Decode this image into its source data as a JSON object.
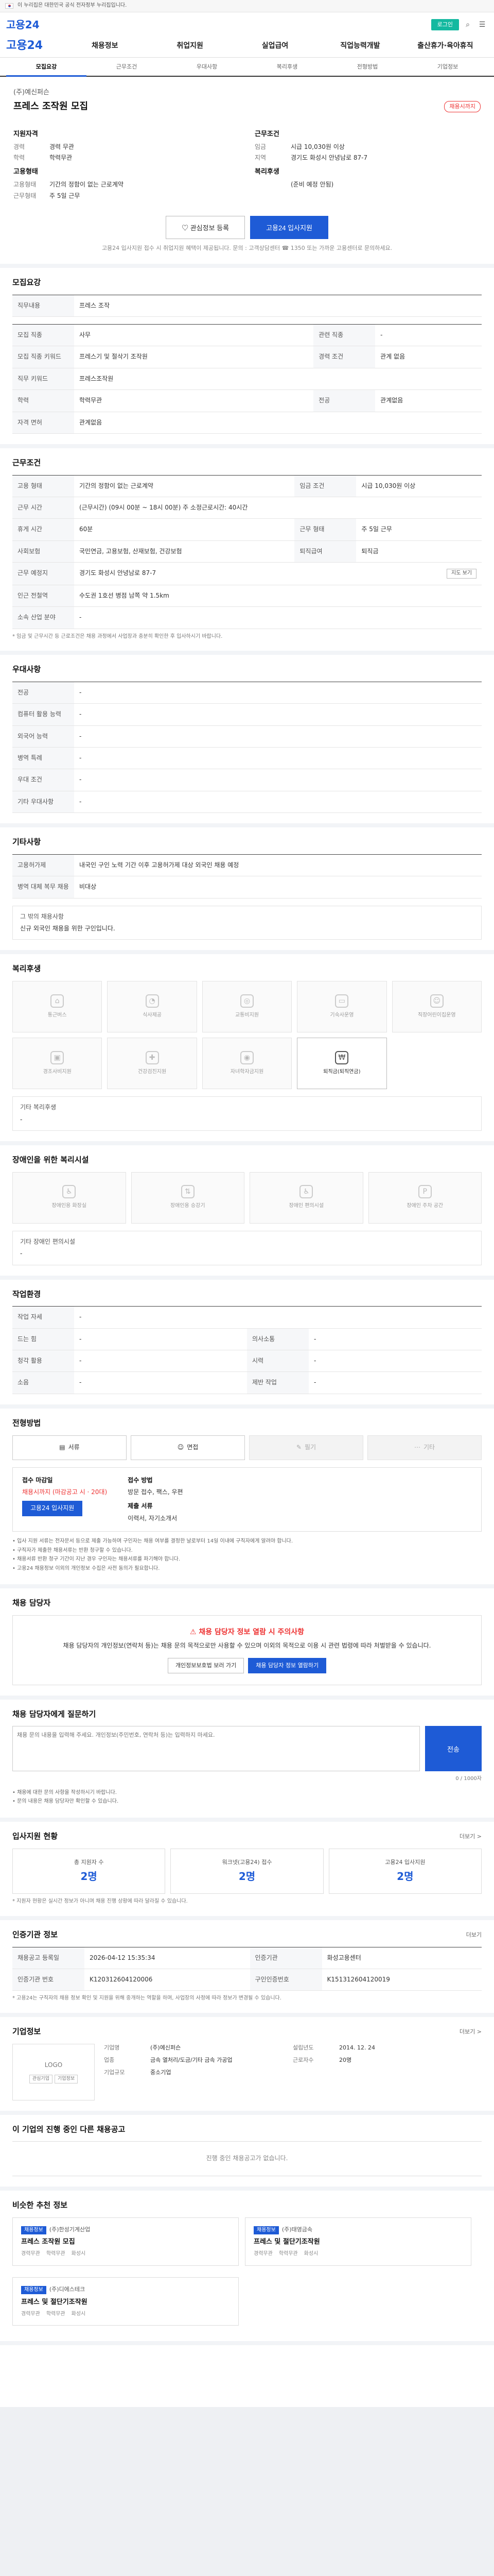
{
  "gov_banner": "이 누리집은 대한민국 공식 전자정부 누리집입니다.",
  "header": {
    "brand": "고용24",
    "login": "로그인"
  },
  "gnb": {
    "logo": "고용24",
    "items": [
      "채용정보",
      "취업지원",
      "실업급여",
      "직업능력개발",
      "출산휴가·육아휴직"
    ]
  },
  "tabs": [
    "모집요강",
    "근무조건",
    "우대사항",
    "복리후생",
    "전형방법",
    "기업정보"
  ],
  "summary": {
    "company": "(주)예신퍼슨",
    "title": "프레스 조작원 모집",
    "status": "채용시까지",
    "left_head": "지원자격",
    "left_rows": [
      {
        "k": "경력",
        "v": "경력 무관"
      },
      {
        "k": "학력",
        "v": "학력무관"
      }
    ],
    "left_head2": "고용형태",
    "left_rows2": [
      {
        "k": "고용형태",
        "v": "기간의 정함이 없는 근로계약"
      },
      {
        "k": "근무형태",
        "v": "주 5일 근무"
      }
    ],
    "right_head": "근무조건",
    "right_rows": [
      {
        "k": "임금",
        "v": "시급 10,030원 이상"
      },
      {
        "k": "지역",
        "v": "경기도 화성시 안녕남로 87-7"
      }
    ],
    "right_head2": "복리후생",
    "right_rows2": [
      {
        "k": "",
        "v": "(준비 예정 안됨)"
      }
    ],
    "save_btn": "관심정보 등록",
    "apply_btn": "고용24 입사지원",
    "note": "고용24 입사지원 접수 시 취업지원 혜택이 제공됩니다. 문의 : 고객상담센터 ☎ 1350 또는 가까운 고용센터로 문의하세요."
  },
  "recruit": {
    "title": "모집요강",
    "duty_label": "직무내용",
    "duty": "프레스 조작",
    "rows": [
      {
        "k": "모집 직종",
        "v": "사무",
        "k2": "관련 직종",
        "v2": "-"
      },
      {
        "k": "모집 직종 키워드",
        "v": "프레스기 및 절삭기 조작원",
        "k2": "경력 조건",
        "v2": "관계 없음"
      },
      {
        "k": "직무 키워드",
        "v": "프레스조작원",
        "k2": "",
        "v2": ""
      },
      {
        "k": "학력",
        "v": "학력무관",
        "k2": "전공",
        "v2": "관계없음"
      },
      {
        "k": "자격 면허",
        "v": "관계없음",
        "k2": "",
        "v2": ""
      }
    ]
  },
  "conditions": {
    "title": "근무조건",
    "rows": [
      {
        "k": "고용 형태",
        "v": "기간의 정함이 없는 근로계약",
        "k2": "임금 조건",
        "v2": "시급 10,030원 이상"
      },
      {
        "k": "근무 시간",
        "v": "(근무시간) (09시 00분 ~ 18시 00분) 주 소정근로시간: 40시간",
        "k2": "",
        "v2": ""
      },
      {
        "k": "휴게 시간",
        "v": "60분",
        "k2": "근무 형태",
        "v2": "주 5일 근무"
      },
      {
        "k": "사회보험",
        "v": "국민연금, 고용보험, 산재보험, 건강보험",
        "k2": "퇴직급여",
        "v2": "퇴직금"
      },
      {
        "k": "근무 예정지",
        "v": "경기도 화성시 안녕남로 87-7",
        "k2": "",
        "v2": ""
      },
      {
        "k": "인근 전철역",
        "v": "수도권 1호선 병점 남쪽 약 1.5km",
        "k2": "",
        "v2": ""
      },
      {
        "k": "소속 산업 분야",
        "v": "-",
        "k2": "",
        "v2": ""
      }
    ],
    "map_btn": "지도 보기",
    "foot": "* 임금 및 근무시간 등 근로조건은 채용 과정에서 사업장과 충분히 확인한 후 입사하시기 바랍니다."
  },
  "preference": {
    "title": "우대사항",
    "rows": [
      {
        "k": "전공",
        "v": "-"
      },
      {
        "k": "컴퓨터 활용 능력",
        "v": "-"
      },
      {
        "k": "외국어 능력",
        "v": "-"
      },
      {
        "k": "병역 특례",
        "v": "-"
      },
      {
        "k": "우대 조건",
        "v": "-"
      },
      {
        "k": "기타 우대사항",
        "v": "-"
      }
    ]
  },
  "other": {
    "title": "기타사항",
    "rows": [
      {
        "k": "고용허가제",
        "v": "내국인 구인 노력 기간 이후 고용허가제 대상 외국인 채용 예정"
      },
      {
        "k": "병역 대체 복무 채용",
        "v": "비대상"
      }
    ],
    "extra_label": "그 밖의 채용사항",
    "extra_value": "신규 외국인 채용을 위한 구인입니다."
  },
  "welfare": {
    "title": "복리후생",
    "items": [
      {
        "icon": "house-icon",
        "label": "통근버스",
        "on": false
      },
      {
        "icon": "meal-icon",
        "label": "식사제공",
        "on": false
      },
      {
        "icon": "car-icon",
        "label": "교통비지원",
        "on": false
      },
      {
        "icon": "bed-icon",
        "label": "기숙사운영",
        "on": false
      },
      {
        "icon": "child-icon",
        "label": "직장어린이집운영",
        "on": false
      },
      {
        "icon": "gift-icon",
        "label": "경조사비지원",
        "on": false
      },
      {
        "icon": "medical-icon",
        "label": "건강검진지원",
        "on": false
      },
      {
        "icon": "coin-icon",
        "label": "자녀학자금지원",
        "on": false
      },
      {
        "icon": "bonus-icon",
        "label": "퇴직금(퇴직연금)",
        "on": true
      }
    ],
    "sub_label": "기타 복리후생",
    "sub_value": "-"
  },
  "disabled": {
    "title": "장애인을 위한 복리시설",
    "items": [
      "장애인용 화장실",
      "장애인용 승강기",
      "장애인 편의시설",
      "장애인 주차 공간"
    ],
    "sub_label": "기타 장애인 편의시설",
    "sub_value": "-"
  },
  "environment": {
    "title": "작업환경",
    "rows": [
      {
        "k": "작업 자세",
        "v": "-",
        "k2": "",
        "v2": ""
      },
      {
        "k": "드는 힘",
        "v": "-",
        "k2": "의사소통",
        "v2": "-"
      },
      {
        "k": "청각 활용",
        "v": "-",
        "k2": "시력",
        "v2": "-"
      },
      {
        "k": "소음",
        "v": "-",
        "k2": "제반 작업",
        "v2": "-"
      }
    ]
  },
  "apply": {
    "title": "전형방법",
    "methods": [
      {
        "label": "서류",
        "on": true
      },
      {
        "label": "면접",
        "on": true
      },
      {
        "label": "필기",
        "on": false
      },
      {
        "label": "기타",
        "on": false
      }
    ],
    "period_label": "접수 마감일",
    "period_value": "채용시까지 (마감공고 시 · 20대)",
    "apply_btn": "고용24 입사지원",
    "method_label": "접수 방법",
    "method_value": "방문 접수, 팩스, 우편",
    "docs_label": "제출 서류",
    "docs_value": "이력서, 자기소개서",
    "bullets": [
      "입사 지원 서류는 전자문서 등으로 제출 가능하며 구인자는 채용 여부를 결정한 날로부터 14일 이내에 구직자에게 알려야 합니다.",
      "구직자가 제출한 채용서류는 반환 청구할 수 있습니다.",
      "채용서류 반환 청구 기간이 지난 경우 구인자는 채용서류를 파기해야 합니다.",
      "고용24 채용정보 이외의 개인정보 수집은 사전 동의가 필요합니다."
    ]
  },
  "contact": {
    "title": "채용 담당자",
    "warn_title": "채용 담당자 정보 열람 시 주의사항",
    "warn_text": "채용 담당자의 개인정보(연락처 등)는 채용 문의 목적으로만 사용할 수 있으며 이외의 목적으로 이용 시 관련 법령에 따라 처벌받을 수 있습니다.",
    "btn1": "개인정보보호법 보러 가기",
    "btn2": "채용 담당자 정보 열람하기"
  },
  "inquiry": {
    "title": "채용 담당자에게 질문하기",
    "placeholder": "채용 문의 내용을 입력해 주세요. 개인정보(주민번호, 연락처 등)는 입력하지 마세요.",
    "btn": "전송",
    "counter": "0 / 1000자",
    "bullets": [
      "채용에 대한 문의 사항을 작성하시기 바랍니다.",
      "문의 내용은 채용 담당자만 확인할 수 있습니다."
    ]
  },
  "status_section": {
    "title": "입사지원 현황",
    "more": "더보기 >",
    "cards": [
      {
        "label": "총 지원자 수",
        "count": "2명"
      },
      {
        "label": "워크넷(고용24) 접수",
        "count": "2명"
      },
      {
        "label": "고용24 입사지원",
        "count": "2명"
      }
    ],
    "note": "* 지원자 현황은 실시간 정보가 아니며 채용 진행 상황에 따라 달라질 수 있습니다."
  },
  "agency": {
    "title": "인증기관 정보",
    "more": "더보기",
    "rows": [
      {
        "k": "채용공고 등록일",
        "v": "2026-04-12 15:35:34",
        "k2": "인증기관",
        "v2": "화성고용센터"
      },
      {
        "k": "인증기관 번호",
        "v": "K120312604120006",
        "k2": "구인인증번호",
        "v2": "K151312604120019"
      }
    ],
    "note": "* 고용24는 구직자의 채용 정보 확인 및 지원을 위해 중개하는 역할을 하며, 사업장의 사정에 따라 정보가 변경될 수 있습니다."
  },
  "company": {
    "title": "기업정보",
    "more": "더보기 >",
    "logo_text": "LOGO",
    "logo_btn1": "관심기업",
    "logo_btn2": "기업정보",
    "rows": [
      {
        "k": "기업명",
        "v": "(주)예신퍼슨",
        "k2": "설립년도",
        "v2": "2014. 12. 24"
      },
      {
        "k": "업종",
        "v": "금속 열처리/도금/기타 금속 가공업",
        "k2": "근로자수",
        "v2": "20명"
      },
      {
        "k": "기업규모",
        "v": "중소기업",
        "k2": "",
        "v2": ""
      }
    ]
  },
  "same_company": {
    "title": "이 기업의 진행 중인 다른 채용공고",
    "empty": "진행 중인 채용공고가 없습니다."
  },
  "recommend": {
    "title": "비슷한 추천 정보",
    "cards": [
      {
        "tag": "채용정보",
        "company": "(주)한성기계산업",
        "title": "프레스 조작원 모집",
        "meta": [
          "경력무관",
          "학력무관",
          "화성시"
        ]
      },
      {
        "tag": "채용정보",
        "company": "(주)태영금속",
        "title": "프레스 및 절단기조작원",
        "meta": [
          "경력무관",
          "학력무관",
          "화성시"
        ]
      },
      {
        "tag": "채용정보",
        "company": "(주)디에스테크",
        "title": "프레스 및 절단기조작원",
        "meta": [
          "경력무관",
          "학력무관",
          "화성시"
        ]
      }
    ]
  }
}
